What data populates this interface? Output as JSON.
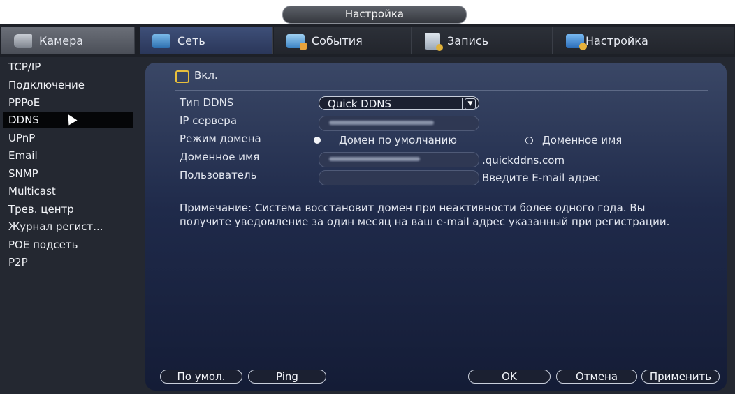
{
  "window": {
    "title": "Настройка"
  },
  "tabs": [
    {
      "label": "Камера",
      "icon": "camera-icon"
    },
    {
      "label": "Сеть",
      "icon": "network-icon"
    },
    {
      "label": "События",
      "icon": "events-icon"
    },
    {
      "label": "Запись",
      "icon": "record-icon"
    },
    {
      "label": "Настройка",
      "icon": "settings-icon"
    }
  ],
  "sidebar": {
    "items": [
      {
        "label": "TCP/IP"
      },
      {
        "label": "Подключение"
      },
      {
        "label": "PPPoE"
      },
      {
        "label": "DDNS"
      },
      {
        "label": "UPnP"
      },
      {
        "label": "Email"
      },
      {
        "label": "SNMP"
      },
      {
        "label": "Multicast"
      },
      {
        "label": "Трев. центр"
      },
      {
        "label": "Журнал регист..."
      },
      {
        "label": "POE подсеть"
      },
      {
        "label": "P2P"
      }
    ],
    "selected": "DDNS"
  },
  "form": {
    "enable_label": "Вкл.",
    "enable_checked": false,
    "ddns_type_label": "Тип DDNS",
    "ddns_type_value": "Quick DDNS",
    "server_ip_label": "IP сервера",
    "domain_mode_label": "Режим домена",
    "domain_mode_default": "Домен по умолчанию",
    "domain_mode_custom": "Доменное имя",
    "domain_mode_selected": "Домен по умолчанию",
    "domain_name_label": "Доменное имя",
    "domain_suffix": ".quickddns.com",
    "user_label": "Пользователь",
    "user_hint": "Введите E-mail адрес",
    "note": "Примечание: Система восстановит домен при неактивности более одного года. Вы получите уведомление за один месяц на ваш e-mail адрес указанный при регистрации."
  },
  "buttons": {
    "default": "По умол.",
    "ping": "Ping",
    "ok": "OK",
    "cancel": "Отмена",
    "apply": "Применить"
  },
  "colors": {
    "accent_checkbox": "#e9bf3b",
    "panel_top": "#3a4766",
    "panel_bottom": "#141c36",
    "tab_active": "#2a3659"
  }
}
